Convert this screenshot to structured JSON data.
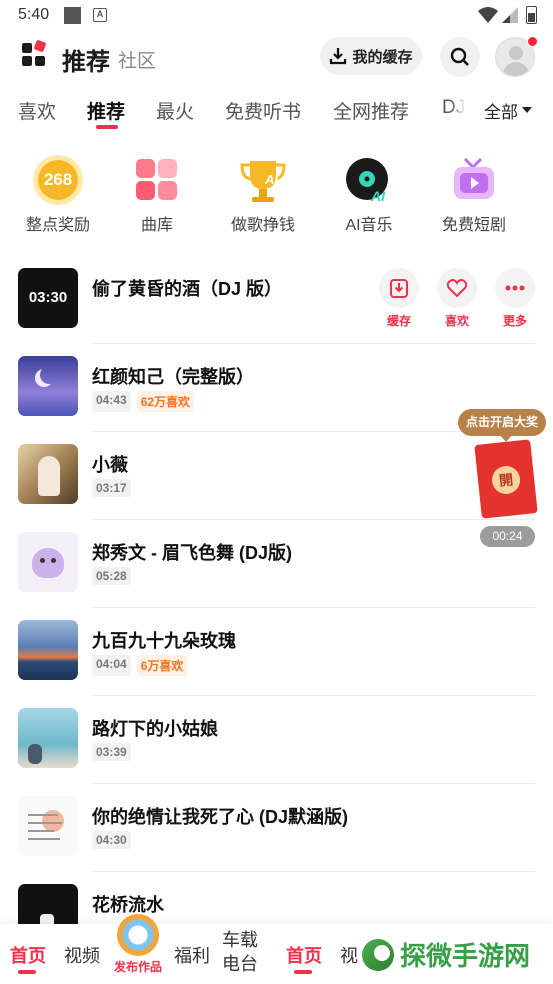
{
  "status_bar": {
    "time": "5:40",
    "notif_letter": "A"
  },
  "header": {
    "title": "推荐",
    "subtitle": "社区",
    "cache_label": "我的缓存"
  },
  "tabs": {
    "items": [
      {
        "label": "喜欢"
      },
      {
        "label": "推荐",
        "active": true
      },
      {
        "label": "最火"
      },
      {
        "label": "免费听书"
      },
      {
        "label": "全网推荐"
      },
      {
        "label": "DJ"
      }
    ],
    "all_label": "全部"
  },
  "shortcuts": [
    {
      "label": "整点奖励",
      "icon": "coin-268-icon",
      "badge": "268"
    },
    {
      "label": "曲库",
      "icon": "library-icon"
    },
    {
      "label": "做歌挣钱",
      "icon": "trophy-ai-icon",
      "badge": "AI"
    },
    {
      "label": "AI音乐",
      "icon": "vinyl-ai-icon",
      "badge": "AI"
    },
    {
      "label": "免费短剧",
      "icon": "tv-play-icon"
    }
  ],
  "songs": [
    {
      "title": "偷了黄昏的酒（DJ 版）",
      "cover_text": "03:30",
      "cover_color": "#111111"
    },
    {
      "title": "红颜知己（完整版）",
      "duration": "04:43",
      "likes": "62万喜欢",
      "cover_color": "#5b5fb8"
    },
    {
      "title": "小薇",
      "duration": "03:17",
      "cover_color": "#c9a272"
    },
    {
      "title": "郑秀文 - 眉飞色舞 (DJ版)",
      "duration": "05:28",
      "cover_color": "#ece7f5"
    },
    {
      "title": "九百九十九朵玫瑰",
      "duration": "04:04",
      "likes": "6万喜欢",
      "cover_color": "#3a6ea6"
    },
    {
      "title": "路灯下的小姑娘",
      "duration": "03:39",
      "cover_color": "#8cc6d8"
    },
    {
      "title": "你的绝情让我死了心 (DJ默涵版)",
      "duration": "04:30",
      "cover_color": "#f5f5f5"
    },
    {
      "title": "花桥流水",
      "cover_color": "#111111"
    }
  ],
  "song_actions": [
    {
      "label": "缓存",
      "icon": "download-icon"
    },
    {
      "label": "喜欢",
      "icon": "heart-icon"
    },
    {
      "label": "更多",
      "icon": "more-dots-icon"
    }
  ],
  "reward": {
    "bubble_label": "点击开启大奖",
    "packet_char": "開",
    "timer": "00:24"
  },
  "bottom_nav": {
    "items": [
      {
        "label": "首页",
        "active": true
      },
      {
        "label": "视频"
      },
      {
        "label": "福利"
      },
      {
        "label": "车载\n电台"
      },
      {
        "label": "首页",
        "active": true
      },
      {
        "label": "视"
      }
    ],
    "publish_label": "发布作品",
    "watermark": "探微手游网"
  },
  "colors": {
    "accent": "#f2304a",
    "likes_text": "#f5731f"
  }
}
